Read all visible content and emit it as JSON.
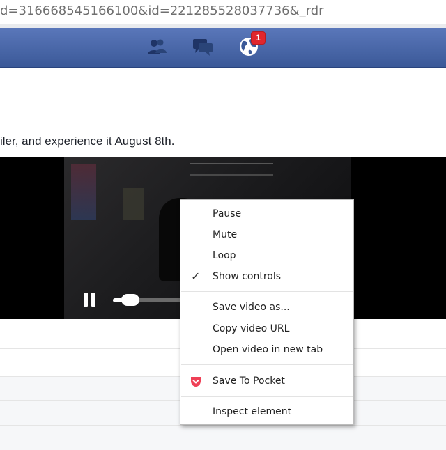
{
  "browser": {
    "url": "d=316668545166100&id=221285528037736&_rdr"
  },
  "facebook_bar": {
    "notification_count": "1",
    "icons": [
      "friend-requests-icon",
      "messages-icon",
      "notifications-globe-icon"
    ],
    "colors": {
      "bar": "#3b5998",
      "badge": "#e0262d"
    }
  },
  "post": {
    "text": "iler, and experience it August 8th."
  },
  "video": {
    "progress": 0.14
  },
  "context_menu": {
    "items": [
      {
        "label": "Pause"
      },
      {
        "label": "Mute"
      },
      {
        "label": "Loop"
      },
      {
        "label": "Show controls",
        "checked": true
      },
      {
        "label": "Save video as..."
      },
      {
        "label": "Copy video URL"
      },
      {
        "label": "Open video in new tab"
      },
      {
        "label": "Save To Pocket",
        "icon": "pocket-icon"
      },
      {
        "label": "Inspect element"
      }
    ],
    "colors": {
      "pocket": "#ef4056"
    }
  }
}
